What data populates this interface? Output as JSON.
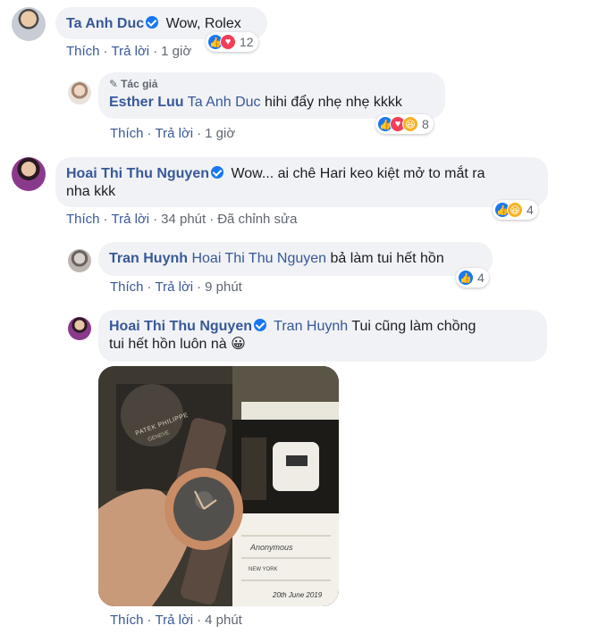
{
  "comments": [
    {
      "author": "Ta Anh Duc",
      "verified": true,
      "text": "Wow, Rolex",
      "actions": {
        "like": "Thích",
        "reply": "Trả lời",
        "time": "1 giờ"
      },
      "reactions": {
        "count": "12",
        "types": [
          "like",
          "love"
        ]
      }
    },
    {
      "author_label": "Tác giả",
      "author": "Esther Luu",
      "tag": "Ta Anh Duc",
      "text": "hihi đẩy nhẹ nhẹ kkkk",
      "actions": {
        "like": "Thích",
        "reply": "Trả lời",
        "time": "1 giờ"
      },
      "reactions": {
        "count": "8",
        "types": [
          "like",
          "love",
          "haha"
        ]
      }
    },
    {
      "author": "Hoai Thi Thu Nguyen",
      "verified": true,
      "text_line1": "Wow... ai chê Hari keo kiệt mở to mắt ra",
      "text_line2": "nha kkk",
      "actions": {
        "like": "Thích",
        "reply": "Trả lời",
        "time": "34 phút",
        "edited": "Đã chỉnh sửa"
      },
      "reactions": {
        "count": "4",
        "types": [
          "like",
          "haha"
        ]
      }
    },
    {
      "author": "Tran Huynh",
      "tag": "Hoai Thi Thu Nguyen",
      "text": "bả làm tui hết hồn",
      "actions": {
        "like": "Thích",
        "reply": "Trả lời",
        "time": "9 phút"
      },
      "reactions": {
        "count": "4",
        "types": [
          "like"
        ]
      }
    },
    {
      "author": "Hoai Thi Thu Nguyen",
      "verified": true,
      "tag": "Tran Huynh",
      "text_line1": "Tui cũng làm chồng",
      "text_line2": "tui hết hồn luôn nà",
      "emoji": "😀",
      "actions": {
        "like": "Thích",
        "reply": "Trả lời",
        "time": "4 phút"
      }
    }
  ],
  "photo": {
    "brand": "PATEK PHILIPPE",
    "city": "GENEVE",
    "card_text": "Anonymous",
    "store": "NEW YORK",
    "date": "20th June 2019"
  },
  "separator": "·"
}
